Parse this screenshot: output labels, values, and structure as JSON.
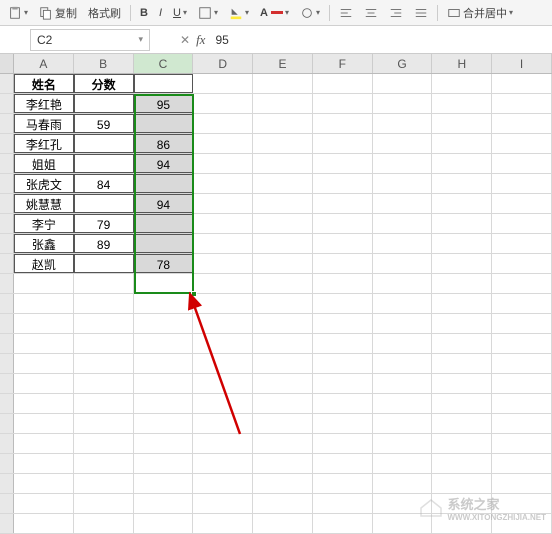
{
  "toolbar": {
    "copy_label": "复制",
    "format_painter_label": "格式刷",
    "merge_label": "合并居中"
  },
  "namebox": {
    "value": "C2"
  },
  "formula": {
    "value": "95"
  },
  "columns": [
    "A",
    "B",
    "C",
    "D",
    "E",
    "F",
    "G",
    "H",
    "I"
  ],
  "header_row": {
    "name": "姓名",
    "score": "分数"
  },
  "rows": [
    {
      "name": "李红艳",
      "b": "",
      "c": "95"
    },
    {
      "name": "马春雨",
      "b": "59",
      "c": ""
    },
    {
      "name": "李红孔",
      "b": "",
      "c": "86"
    },
    {
      "name": "姐姐",
      "b": "",
      "c": "94"
    },
    {
      "name": "张虎文",
      "b": "84",
      "c": ""
    },
    {
      "name": "姚慧慧",
      "b": "",
      "c": "94"
    },
    {
      "name": "李宁",
      "b": "79",
      "c": ""
    },
    {
      "name": "张鑫",
      "b": "89",
      "c": ""
    },
    {
      "name": "赵凯",
      "b": "",
      "c": "78"
    }
  ],
  "watermark": {
    "text": "系统之家",
    "url": "WWW.XITONGZHIJIA.NET"
  }
}
